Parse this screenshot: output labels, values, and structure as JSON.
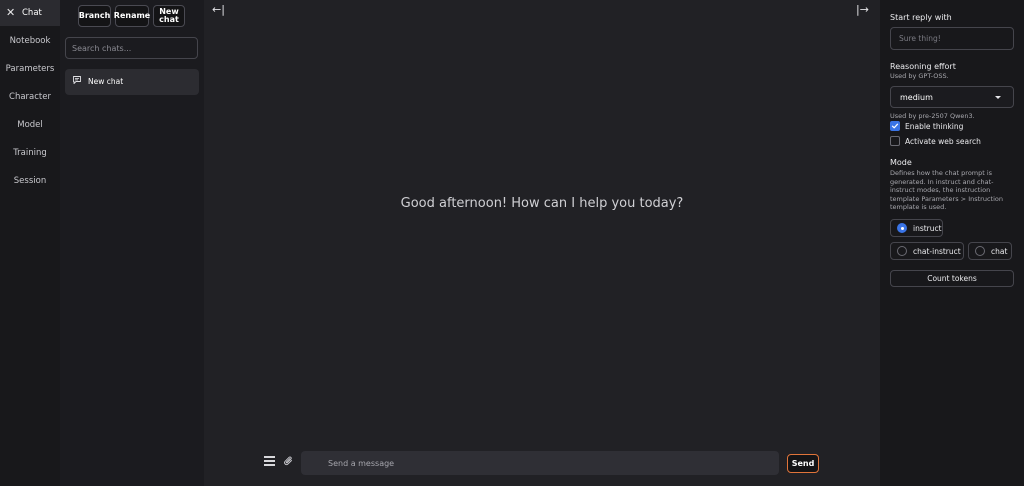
{
  "nav": {
    "items": [
      {
        "label": "Chat",
        "active": true
      },
      {
        "label": "Notebook"
      },
      {
        "label": "Parameters"
      },
      {
        "label": "Character"
      },
      {
        "label": "Model"
      },
      {
        "label": "Training"
      },
      {
        "label": "Session"
      }
    ],
    "close_icon": "close-icon"
  },
  "chats_panel": {
    "branch_label": "Branch",
    "rename_label": "Rename",
    "new_chat_label": "New chat",
    "search_placeholder": "Search chats...",
    "chat_items": [
      {
        "label": "New chat",
        "icon": "chat-bubble-icon"
      }
    ]
  },
  "main": {
    "greeting": "Good afternoon! How can I help you today?",
    "collapse_left_icon": "←|",
    "collapse_right_icon": "|→",
    "message_placeholder": "Send a message",
    "send_label": "Send"
  },
  "right_panel": {
    "start_reply_label": "Start reply with",
    "start_reply_placeholder": "Sure thing!",
    "reasoning_label": "Reasoning effort",
    "reasoning_sub": "Used by GPT-OSS.",
    "reasoning_value": "medium",
    "thinking_sub": "Used by pre-2507 Qwen3.",
    "enable_thinking_label": "Enable thinking",
    "enable_thinking_checked": true,
    "web_search_label": "Activate web search",
    "web_search_checked": false,
    "mode_label": "Mode",
    "mode_desc": "Defines how the chat prompt is generated. In instruct and chat-instruct modes, the instruction template Parameters > Instruction template is used.",
    "modes": [
      {
        "label": "instruct",
        "selected": true
      },
      {
        "label": "chat-instruct",
        "selected": false
      },
      {
        "label": "chat",
        "selected": false
      }
    ],
    "count_tokens_label": "Count tokens"
  },
  "colors": {
    "accent_blue": "#3a74e6",
    "send_border": "#e0743a",
    "background": "#212125"
  }
}
